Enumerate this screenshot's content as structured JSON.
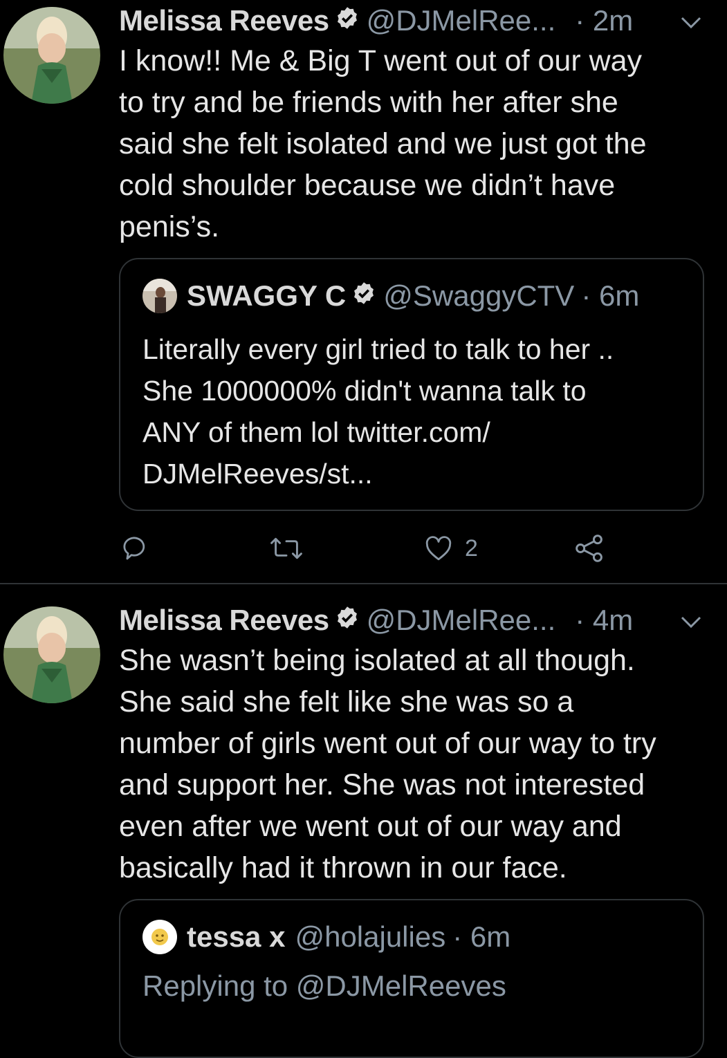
{
  "tweets": [
    {
      "author": "Melissa Reeves",
      "handle": "@DJMelRee...",
      "time": "· 2m",
      "text": "I know!! Me & Big T went out of our way\nto try and be friends with her after she\nsaid she felt isolated and we just got the\ncold shoulder because we didn’t have\npenis’s.",
      "quote": {
        "author": "SWAGGY C",
        "handle": "@SwaggyCTV",
        "time": "· 6m",
        "text": "Literally every girl tried to talk to her ..\nShe 1000000% didn't wanna talk to\nANY of them lol twitter.com/\nDJMelReeves/st..."
      },
      "actions": {
        "likes": "2"
      }
    },
    {
      "author": "Melissa Reeves",
      "handle": "@DJMelRee...",
      "time": "· 4m",
      "text": "She wasn’t being isolated at all though.\nShe said she felt like she was so a\nnumber of girls went out of our way to try\nand support her. She was not interested\neven after we went out of our way and\nbasically had it thrown in our face.",
      "quote": {
        "author": "tessa x",
        "handle": "@holajulies",
        "time": "· 6m",
        "replying_to": "Replying to @DJMelReeves"
      }
    }
  ],
  "colors": {
    "background": "#000000",
    "text": "#e6e6e6",
    "secondary": "#8b98a5",
    "border": "#2f3336"
  },
  "icons": [
    "verified-badge-icon",
    "chevron-down-icon",
    "reply-icon",
    "retweet-icon",
    "like-icon",
    "share-icon"
  ]
}
